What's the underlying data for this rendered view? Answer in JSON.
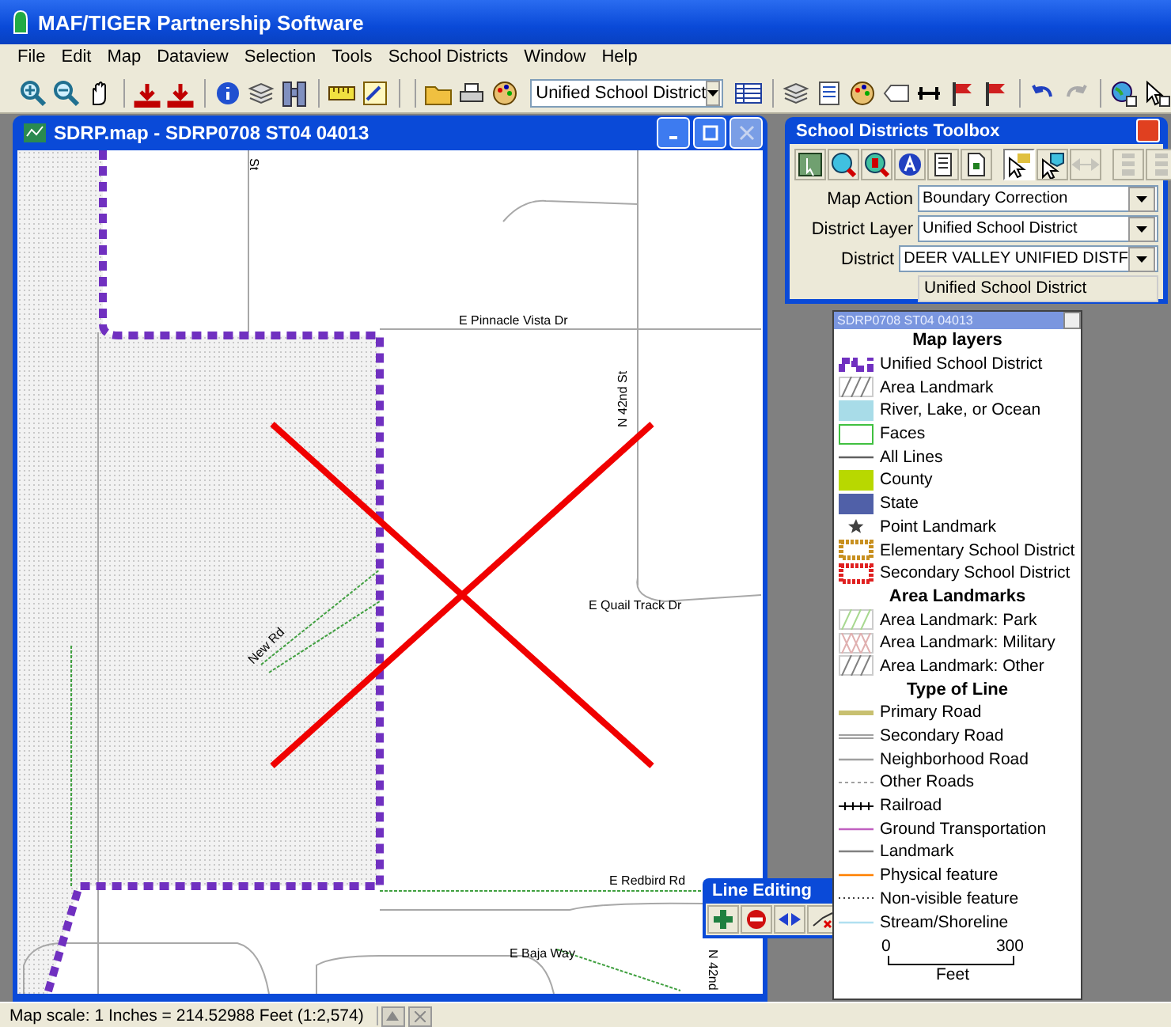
{
  "app_title": "MAF/TIGER Partnership Software",
  "menu": [
    "File",
    "Edit",
    "Map",
    "Dataview",
    "Selection",
    "Tools",
    "School Districts",
    "Window",
    "Help"
  ],
  "toolbar": {
    "layer_select": "Unified School District"
  },
  "map_window": {
    "title": "SDRP.map - SDRP0708 ST04 04013",
    "labels": [
      "St",
      "E Pinnacle Vista Dr",
      "N 42nd St",
      "E Quail Track Dr",
      "New Rd",
      "E Redbird Rd",
      "E Baja Way",
      "N 42nd"
    ]
  },
  "toolbox": {
    "title": "School Districts Toolbox",
    "tools": [
      {
        "selected": false,
        "disabled": false
      },
      {
        "selected": false,
        "disabled": false
      },
      {
        "selected": false,
        "disabled": false
      },
      {
        "selected": false,
        "disabled": false
      },
      {
        "selected": false,
        "disabled": false
      },
      {
        "selected": false,
        "disabled": false
      },
      {
        "selected": true,
        "disabled": false
      },
      {
        "selected": false,
        "disabled": false
      },
      {
        "selected": false,
        "disabled": true
      },
      {
        "selected": false,
        "disabled": true
      },
      {
        "selected": false,
        "disabled": true
      }
    ],
    "fields": [
      {
        "label": "Map Action",
        "value": "Boundary Correction"
      },
      {
        "label": "District Layer",
        "value": "Unified School District"
      },
      {
        "label": "District",
        "value": "DEER VALLEY UNIFIED DISTF"
      }
    ],
    "info": "Unified School District"
  },
  "legend": {
    "title": "SDRP0708 ST04 04013",
    "items": [
      {
        "kind": "heading",
        "label": "Map layers"
      },
      {
        "kind": "dashed-area",
        "label": "Unified School District",
        "color": "#7030c0"
      },
      {
        "kind": "hatch",
        "label": "Area Landmark",
        "color": "#808080"
      },
      {
        "kind": "fill",
        "label": "River, Lake, or Ocean",
        "color": "#a8dce8"
      },
      {
        "kind": "outline",
        "label": "Faces",
        "color": "#40c040"
      },
      {
        "kind": "line",
        "label": "All Lines",
        "color": "#606060"
      },
      {
        "kind": "fill",
        "label": "County",
        "color": "#b8d800"
      },
      {
        "kind": "fill",
        "label": "State",
        "color": "#5060a8"
      },
      {
        "kind": "star",
        "label": "Point Landmark",
        "color": "#404040"
      },
      {
        "kind": "dotted-border",
        "label": "Elementary School District",
        "color": "#c89020"
      },
      {
        "kind": "dotted-border",
        "label": "Secondary School District",
        "color": "#e02020"
      },
      {
        "kind": "heading",
        "label": "Area Landmarks"
      },
      {
        "kind": "hatch",
        "label": "Area Landmark: Park",
        "color": "#a8d890"
      },
      {
        "kind": "cross-hatch",
        "label": "Area Landmark: Military",
        "color": "#e0b0b0"
      },
      {
        "kind": "hatch",
        "label": "Area Landmark: Other",
        "color": "#808080"
      },
      {
        "kind": "heading",
        "label": "Type of Line"
      },
      {
        "kind": "thick-line",
        "label": "Primary Road",
        "color": "#c8c070"
      },
      {
        "kind": "double-line",
        "label": "Secondary Road",
        "color": "#a0a0a0"
      },
      {
        "kind": "line",
        "label": "Neighborhood Road",
        "color": "#a0a0a0"
      },
      {
        "kind": "dashed",
        "label": "Other Roads",
        "color": "#a0a0a0"
      },
      {
        "kind": "railroad",
        "label": "Railroad",
        "color": "#000000"
      },
      {
        "kind": "line",
        "label": "Ground Transportation",
        "color": "#c060c0"
      },
      {
        "kind": "line",
        "label": "Landmark",
        "color": "#808080"
      },
      {
        "kind": "line",
        "label": "Physical feature",
        "color": "#ff8000"
      },
      {
        "kind": "dotted",
        "label": "Non-visible feature",
        "color": "#404040"
      },
      {
        "kind": "line",
        "label": "Stream/Shoreline",
        "color": "#b0e0f0"
      }
    ],
    "scale": {
      "min": "0",
      "max": "300",
      "unit": "Feet"
    }
  },
  "line_editing": {
    "title": "Line Editing"
  },
  "status_bar": {
    "scale": "Map scale: 1 Inches = 214.52988 Feet (1:2,574)"
  }
}
